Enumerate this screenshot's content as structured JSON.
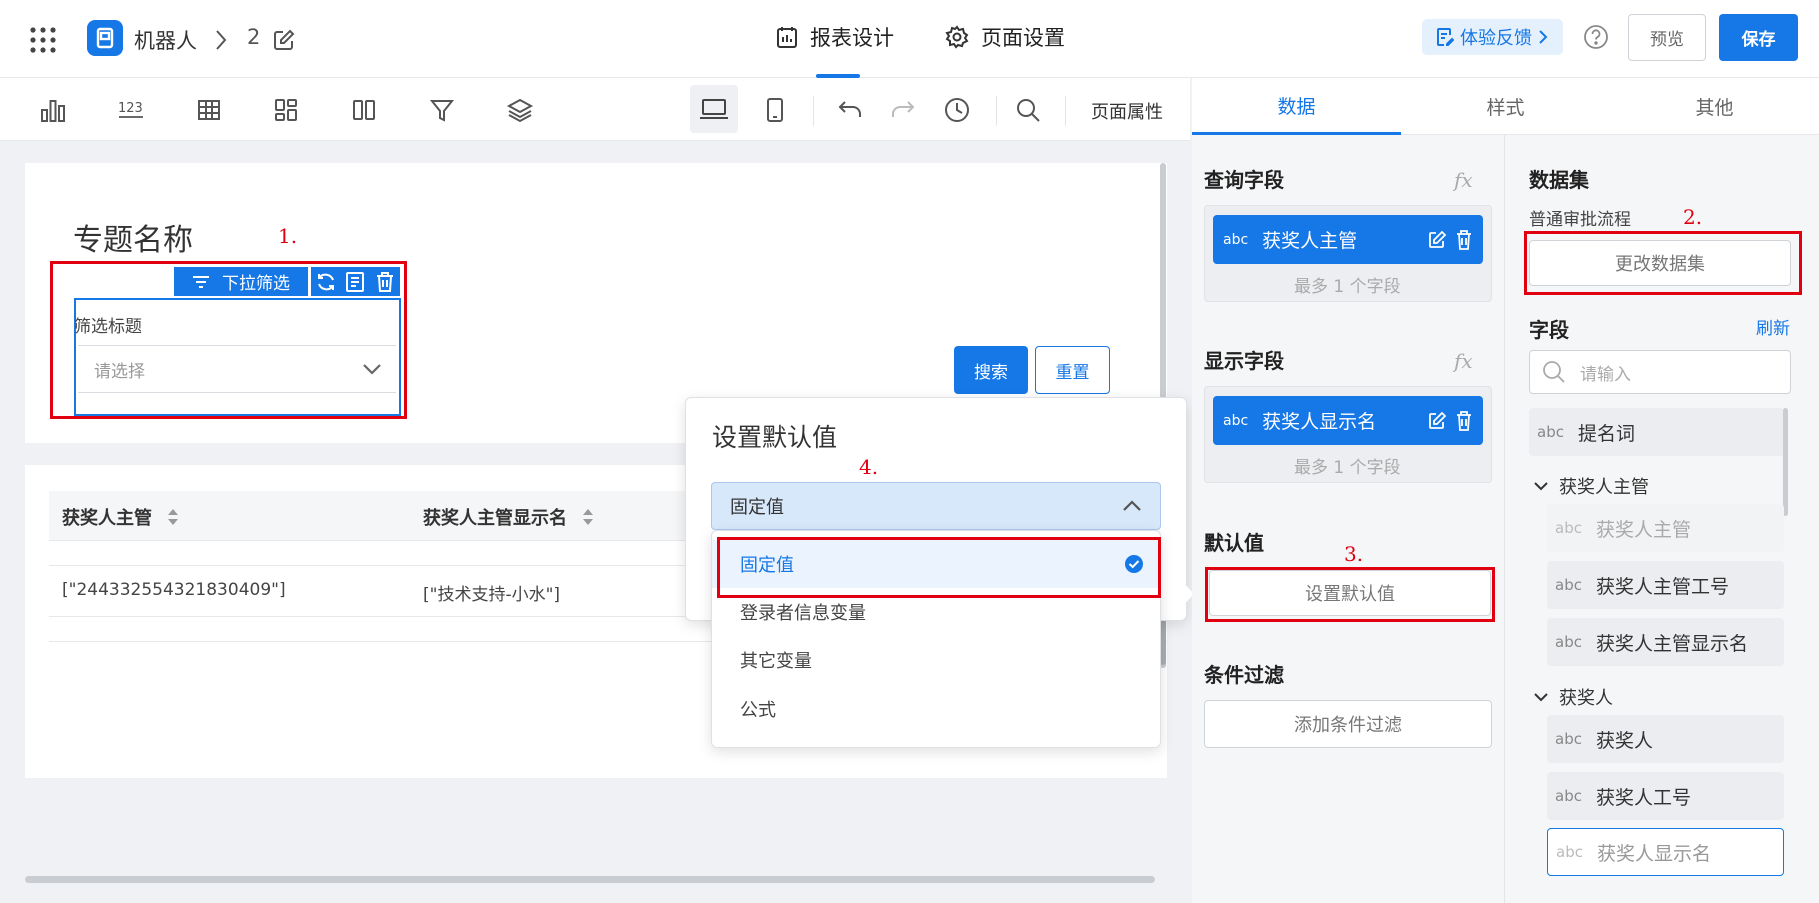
{
  "header": {
    "app_name": "机器人",
    "page_number": "2",
    "tabs": [
      "报表设计",
      "页面设置"
    ],
    "feedback": "体验反馈",
    "preview": "预览",
    "save": "保存"
  },
  "toolbar": {
    "page_props": "页面属性"
  },
  "canvas": {
    "title": "专题名称",
    "filter_tag": "下拉筛选",
    "filter_title": "筛选标题",
    "filter_placeholder": "请选择",
    "search": "搜索",
    "reset": "重置",
    "columns": [
      "获奖人主管",
      "获奖人主管显示名"
    ],
    "row": [
      "[\"244332554321830409\"]",
      "[\"技术支持-小水\"]"
    ]
  },
  "default_popup": {
    "title": "设置默认值",
    "selected": "固定值",
    "options": [
      "固定值",
      "登录者信息变量",
      "其它变量",
      "公式"
    ]
  },
  "annotations": [
    "1.",
    "2.",
    "3.",
    "4."
  ],
  "panel": {
    "tabs": [
      "数据",
      "样式",
      "其他"
    ],
    "query_field": {
      "title": "查询字段",
      "chip": "获奖人主管",
      "hint": "最多 1 个字段"
    },
    "display_field": {
      "title": "显示字段",
      "chip": "获奖人显示名",
      "hint": "最多 1 个字段"
    },
    "default_value": {
      "title": "默认值",
      "button": "设置默认值"
    },
    "condition": {
      "title": "条件过滤",
      "button": "添加条件过滤"
    },
    "fx": "fx",
    "abc": "abc"
  },
  "dataset": {
    "title": "数据集",
    "name": "普通审批流程",
    "change": "更改数据集",
    "fields_title": "字段",
    "refresh": "刷新",
    "search_placeholder": "请输入",
    "fields": {
      "f0": "提名词",
      "g1": "获奖人主管",
      "g1_items": [
        "获奖人主管",
        "获奖人主管工号",
        "获奖人主管显示名"
      ],
      "g2": "获奖人",
      "g2_items": [
        "获奖人",
        "获奖人工号",
        "获奖人显示名"
      ]
    }
  },
  "colors": {
    "primary": "#1677e6",
    "annotation_red": "#e0000f"
  }
}
